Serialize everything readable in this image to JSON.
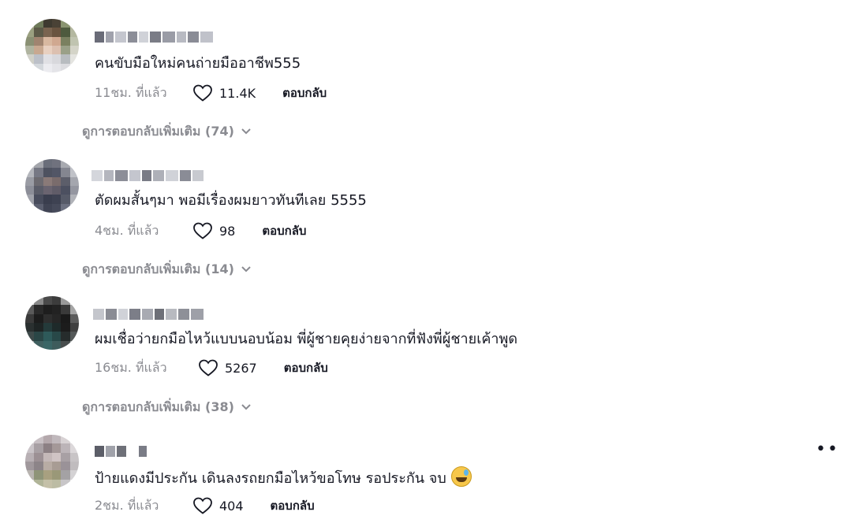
{
  "comments": [
    {
      "text": "คนขับมือใหม่คนถ่ายมืออาชีพ555",
      "time": "11ชม. ที่แล้ว",
      "likes": "11.4K",
      "reply_label": "ตอบกลับ",
      "more_replies": "ดูการตอบกลับเพิ่มเติม (74)"
    },
    {
      "text": "ตัดผมสั้นๆมา พอมีเรื่องผมยาวทันทีเลย 5555",
      "time": "4ชม. ที่แล้ว",
      "likes": "98",
      "reply_label": "ตอบกลับ",
      "more_replies": "ดูการตอบกลับเพิ่มเติม (14)"
    },
    {
      "text": "ผมเชื่อว่ายกมือไหว้แบบนอบน้อม พี่ผู้ชายคุยง่ายจากที่ฟังพี่ผู้ชายเค้าพูด",
      "time": "16ชม. ที่แล้ว",
      "likes": "5267",
      "reply_label": "ตอบกลับ",
      "more_replies": "ดูการตอบกลับเพิ่มเติม (38)"
    },
    {
      "text": "ป้ายแดงมีประกัน เดินลงรถยกมือไหว้ขอโทษ รอประกัน จบ",
      "time": "2ชม. ที่แล้ว",
      "likes": "404",
      "reply_label": "ตอบกลับ"
    }
  ],
  "icons": {
    "like": "heart-outline-icon",
    "expand": "chevron-down-icon",
    "options": "more-dots-icon",
    "emoji": "sweat-smile-emoji-icon"
  },
  "colors": {
    "text": "#161823",
    "secondary": "#8a8b91"
  }
}
